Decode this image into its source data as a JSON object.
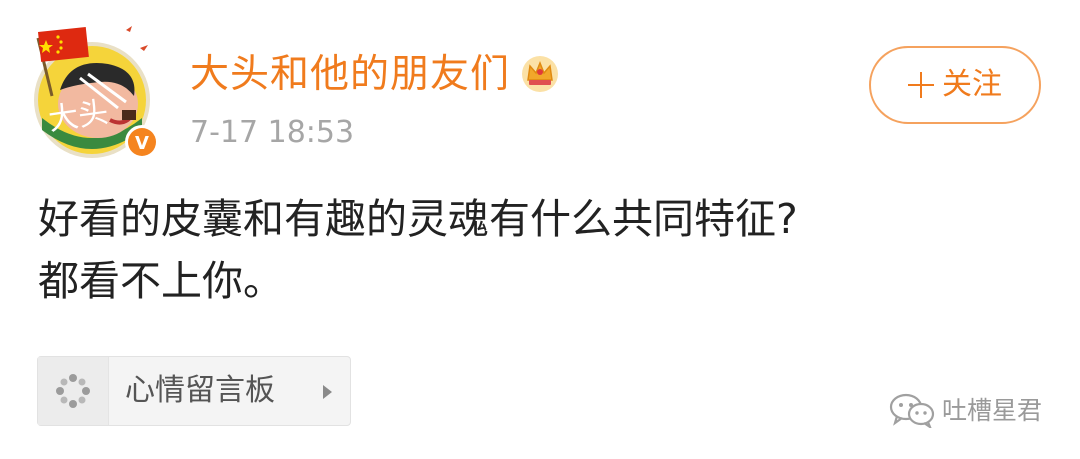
{
  "post": {
    "author": {
      "name": "大头和他的朋友们",
      "avatar_text": "大头",
      "verified_badge": "V",
      "membership_icon": "crown-icon"
    },
    "timestamp": "7-17 18:53",
    "follow_button": {
      "label": "关注",
      "icon": "plus-icon"
    },
    "body_lines": [
      "好看的皮囊和有趣的灵魂有什么共同特征?",
      "都看不上你。"
    ],
    "topic": {
      "icon": "topic-dots-icon",
      "label": "心情留言板",
      "arrow_icon": "chevron-right-icon"
    }
  },
  "watermark": {
    "icon": "wechat-icon",
    "text": "吐槽星君"
  },
  "colors": {
    "accent": "#f07b1d",
    "follow_border": "#f5a25e",
    "timestamp": "#a6a6a6",
    "body_text": "#222222",
    "chip_bg": "#f4f4f4",
    "verified_badge": "#f5841f",
    "watermark_text": "#9a9a9a"
  }
}
